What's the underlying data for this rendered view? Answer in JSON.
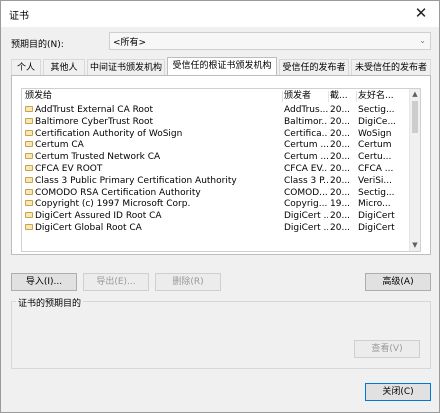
{
  "window": {
    "title": "证书",
    "close_glyph": "✕"
  },
  "purpose": {
    "label": "预期目的(N):",
    "value": "<所有>",
    "arrow": "⌄"
  },
  "tabs": [
    {
      "label": "个人"
    },
    {
      "label": "其他人"
    },
    {
      "label": "中间证书颁发机构"
    },
    {
      "label": "受信任的根证书颁发机构"
    },
    {
      "label": "受信任的发布者"
    },
    {
      "label": "未受信任的发布者"
    }
  ],
  "active_tab": 3,
  "table": {
    "headers": [
      "颁发给",
      "颁发者",
      "截...",
      "友好名..."
    ],
    "rows": [
      [
        "AddTrust External CA Root",
        "AddTrus...",
        "20...",
        "Sectig..."
      ],
      [
        "Baltimore CyberTrust Root",
        "Baltimor...",
        "20...",
        "DigiCe..."
      ],
      [
        "Certification Authority of WoSign",
        "Certifica...",
        "20...",
        "WoSign"
      ],
      [
        "Certum CA",
        "Certum ...",
        "20...",
        "Certum"
      ],
      [
        "Certum Trusted Network CA",
        "Certum ...",
        "20...",
        "Certu..."
      ],
      [
        "CFCA EV ROOT",
        "CFCA EV...",
        "20...",
        "CFCA ..."
      ],
      [
        "Class 3 Public Primary Certification Authority",
        "Class 3 P...",
        "20...",
        "VeriSi..."
      ],
      [
        "COMODO RSA Certification Authority",
        "COMOD...",
        "20...",
        "Sectig..."
      ],
      [
        "Copyright (c) 1997 Microsoft Corp.",
        "Copyrig...",
        "19...",
        "Micro..."
      ],
      [
        "DigiCert Assured ID Root CA",
        "DigiCert ...",
        "20...",
        "DigiCert"
      ],
      [
        "DigiCert Global Root CA",
        "DigiCert ...",
        "20...",
        "DigiCert"
      ]
    ]
  },
  "buttons": {
    "import": "导入(I)...",
    "export": "导出(E)...",
    "remove": "删除(R)",
    "advanced": "高级(A)",
    "view": "查看(V)",
    "close": "关闭(C)"
  },
  "purposes_group": {
    "title": "证书的预期目的"
  },
  "icons": {
    "cert": "certificate-icon",
    "scroll_up": "▲",
    "scroll_down": "▼"
  }
}
